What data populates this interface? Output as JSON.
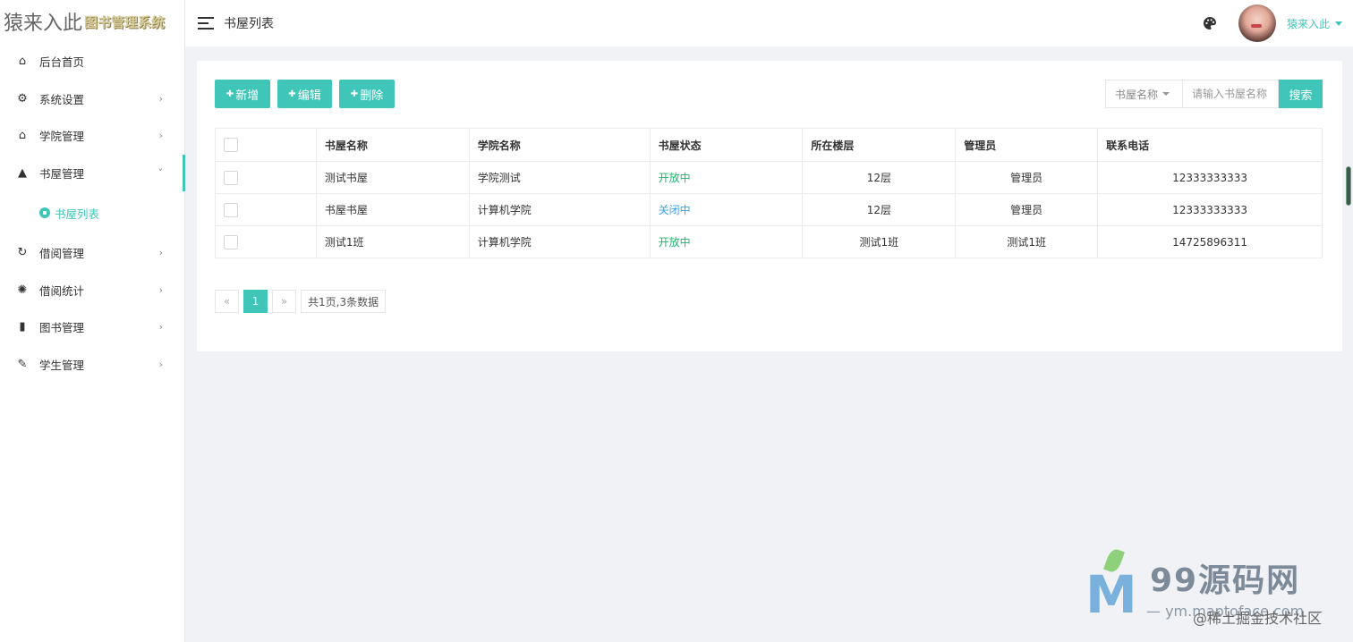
{
  "logo": {
    "main": "猿来入此",
    "sub": "图书管理系统"
  },
  "sidebar": {
    "items": [
      {
        "label": "后台首页",
        "icon": "home-icon",
        "glyph": "⌂",
        "has_arrow": false
      },
      {
        "label": "系统设置",
        "icon": "gear-icon",
        "glyph": "⚙",
        "has_arrow": true
      },
      {
        "label": "学院管理",
        "icon": "house-outline-icon",
        "glyph": "⌂",
        "has_arrow": true
      },
      {
        "label": "书屋管理",
        "icon": "graduation-cap-icon",
        "glyph": "▲",
        "has_arrow": true,
        "expanded": true
      },
      {
        "label": "借阅管理",
        "icon": "refresh-icon",
        "glyph": "↻",
        "has_arrow": true
      },
      {
        "label": "借阅统计",
        "icon": "aperture-icon",
        "glyph": "✺",
        "has_arrow": true
      },
      {
        "label": "图书管理",
        "icon": "trash-icon",
        "glyph": "▮",
        "has_arrow": true
      },
      {
        "label": "学生管理",
        "icon": "pencil-icon",
        "glyph": "✎",
        "has_arrow": true
      }
    ],
    "submenu": {
      "label": "书屋列表"
    },
    "arrow_right": "›",
    "arrow_down": "˅"
  },
  "header": {
    "title": "书屋列表",
    "username": "猿来入此"
  },
  "toolbar": {
    "add_label": "新增",
    "edit_label": "编辑",
    "delete_label": "删除",
    "btn_glyph": "✚"
  },
  "search": {
    "field": "书屋名称",
    "placeholder": "请输入书屋名称",
    "button": "搜索"
  },
  "table": {
    "headers": [
      "书屋名称",
      "学院名称",
      "书屋状态",
      "所在楼层",
      "管理员",
      "联系电话"
    ],
    "rows": [
      {
        "name": "测试书屋",
        "college": "学院测试",
        "status": "开放中",
        "status_type": "open",
        "floor": "12层",
        "admin": "管理员",
        "phone": "12333333333"
      },
      {
        "name": "书屋书屋",
        "college": "计算机学院",
        "status": "关闭中",
        "status_type": "closed",
        "floor": "12层",
        "admin": "管理员",
        "phone": "12333333333"
      },
      {
        "name": "测试1班",
        "college": "计算机学院",
        "status": "开放中",
        "status_type": "open",
        "floor": "测试1班",
        "admin": "测试1班",
        "phone": "14725896311"
      }
    ]
  },
  "pager": {
    "prev": "«",
    "current": "1",
    "next": "»",
    "info": "共1页,3条数据"
  },
  "watermark": {
    "letter": "M",
    "title": "99源码网",
    "url": "— ym.maptoface.com —",
    "credit": "@稀土掘金技术社区"
  },
  "colors": {
    "accent": "#3fc6b8",
    "status_open": "#1eb56c",
    "status_closed": "#3aa3e3"
  }
}
